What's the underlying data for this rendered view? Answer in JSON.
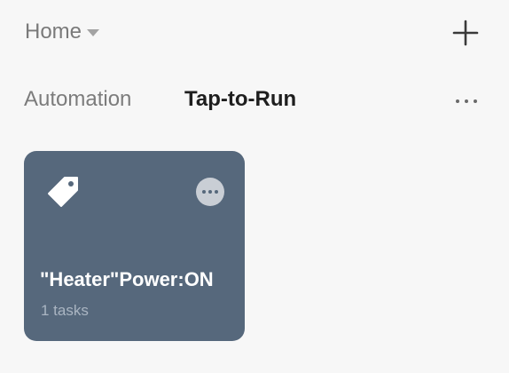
{
  "header": {
    "home_label": "Home"
  },
  "tabs": [
    {
      "label": "Automation",
      "active": false
    },
    {
      "label": "Tap-to-Run",
      "active": true
    }
  ],
  "scenes": [
    {
      "title": "\"Heater\"Power:ON",
      "subtitle": "1 tasks",
      "icon": "tag-icon",
      "color": "#56687c"
    }
  ],
  "colors": {
    "background": "#f7f7f7",
    "card": "#56687c",
    "active_tab": "#1e1e1e",
    "inactive_tab": "#7c7c7c"
  }
}
